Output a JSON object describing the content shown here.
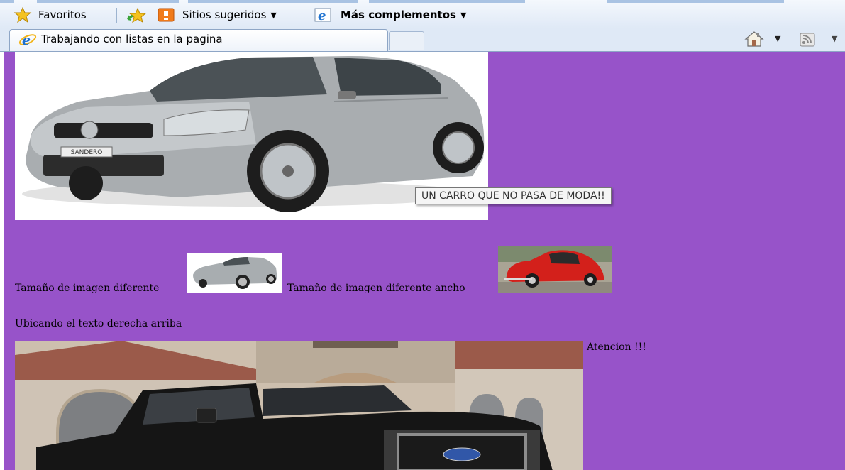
{
  "favorites_bar": {
    "favorites_label": "Favoritos",
    "suggested_sites_label": "Sitios sugeridos",
    "more_addons_label": "Más complementos"
  },
  "tab": {
    "title": "Trabajando con listas en la pagina"
  },
  "page": {
    "background_color": "#9753c9",
    "tooltip": "UN CARRO QUE NO PASA DE MODA!!",
    "caption_1": "Tamaño de imagen diferente",
    "caption_2": "Tamaño de imagen diferente ancho",
    "caption_3": "Ubicando el texto derecha arriba",
    "caption_4": "Atencion !!!",
    "sandero_badge": "SANDERO"
  }
}
